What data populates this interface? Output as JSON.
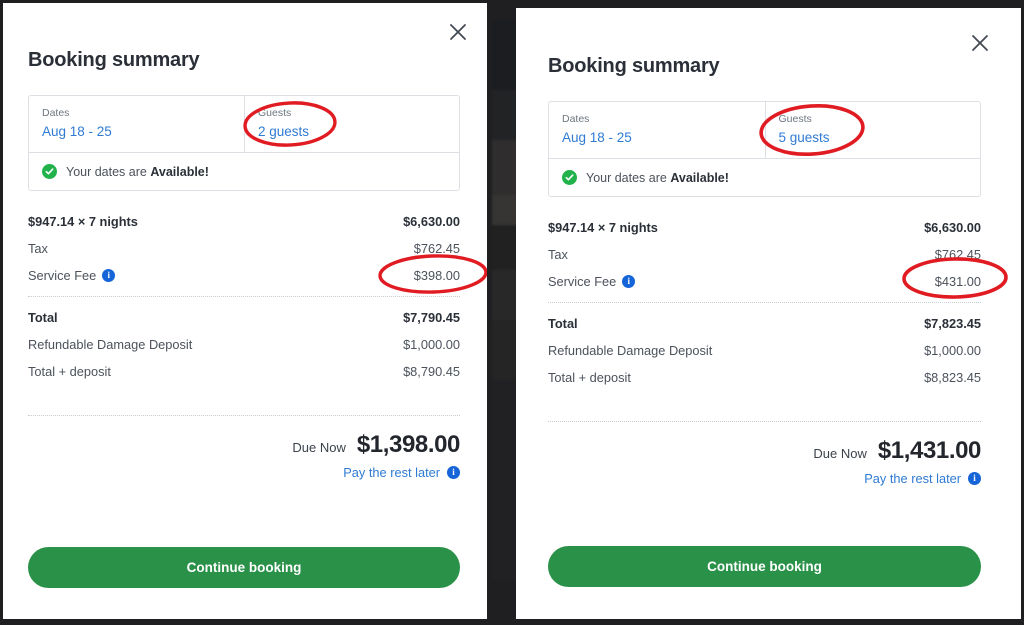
{
  "panels": [
    {
      "id": "left",
      "title": "Booking summary",
      "close_label": "close-icon",
      "details": {
        "dates_label": "Dates",
        "dates_value": "Aug 18 - 25",
        "guests_label": "Guests",
        "guests_value": "2 guests",
        "availability_prefix": "Your dates are ",
        "availability_status": "Available!"
      },
      "price_rows": [
        {
          "label": "$947.14 × 7 nights",
          "value": "$6,630.00",
          "bold": true,
          "info": false
        },
        {
          "label": "Tax",
          "value": "$762.45",
          "bold": false,
          "info": false
        },
        {
          "label": "Service Fee",
          "value": "$398.00",
          "bold": false,
          "info": true
        }
      ],
      "total_rows": [
        {
          "label": "Total",
          "value": "$7,790.45",
          "bold": true
        },
        {
          "label": "Refundable Damage Deposit",
          "value": "$1,000.00",
          "bold": false
        },
        {
          "label": "Total + deposit",
          "value": "$8,790.45",
          "bold": false
        }
      ],
      "due": {
        "label": "Due Now",
        "amount": "$1,398.00",
        "pay_later": "Pay the rest later"
      },
      "cta_label": "Continue booking"
    },
    {
      "id": "right",
      "title": "Booking summary",
      "close_label": "close-icon",
      "details": {
        "dates_label": "Dates",
        "dates_value": "Aug 18 - 25",
        "guests_label": "Guests",
        "guests_value": "5 guests",
        "availability_prefix": "Your dates are ",
        "availability_status": "Available!"
      },
      "price_rows": [
        {
          "label": "$947.14 × 7 nights",
          "value": "$6,630.00",
          "bold": true,
          "info": false
        },
        {
          "label": "Tax",
          "value": "$762.45",
          "bold": false,
          "info": false
        },
        {
          "label": "Service Fee",
          "value": "$431.00",
          "bold": false,
          "info": true
        }
      ],
      "total_rows": [
        {
          "label": "Total",
          "value": "$7,823.45",
          "bold": true
        },
        {
          "label": "Refundable Damage Deposit",
          "value": "$1,000.00",
          "bold": false
        },
        {
          "label": "Total + deposit",
          "value": "$8,823.45",
          "bold": false
        }
      ],
      "due": {
        "label": "Due Now",
        "amount": "$1,431.00",
        "pay_later": "Pay the rest later"
      },
      "cta_label": "Continue booking"
    }
  ],
  "annotations": {
    "color": "#e01b22",
    "items": [
      {
        "target": "left-guests-value",
        "shape": "ellipse"
      },
      {
        "target": "left-service-fee-value",
        "shape": "ellipse"
      },
      {
        "target": "right-guests-value",
        "shape": "ellipse"
      },
      {
        "target": "right-service-fee-value",
        "shape": "ellipse"
      }
    ]
  },
  "colors": {
    "cta_green": "#2a9149",
    "link_blue": "#2f7bd4",
    "info_blue": "#1565d8",
    "check_green": "#22b24c",
    "annotation_red": "#e01b22",
    "backdrop": "#2e2e31"
  }
}
